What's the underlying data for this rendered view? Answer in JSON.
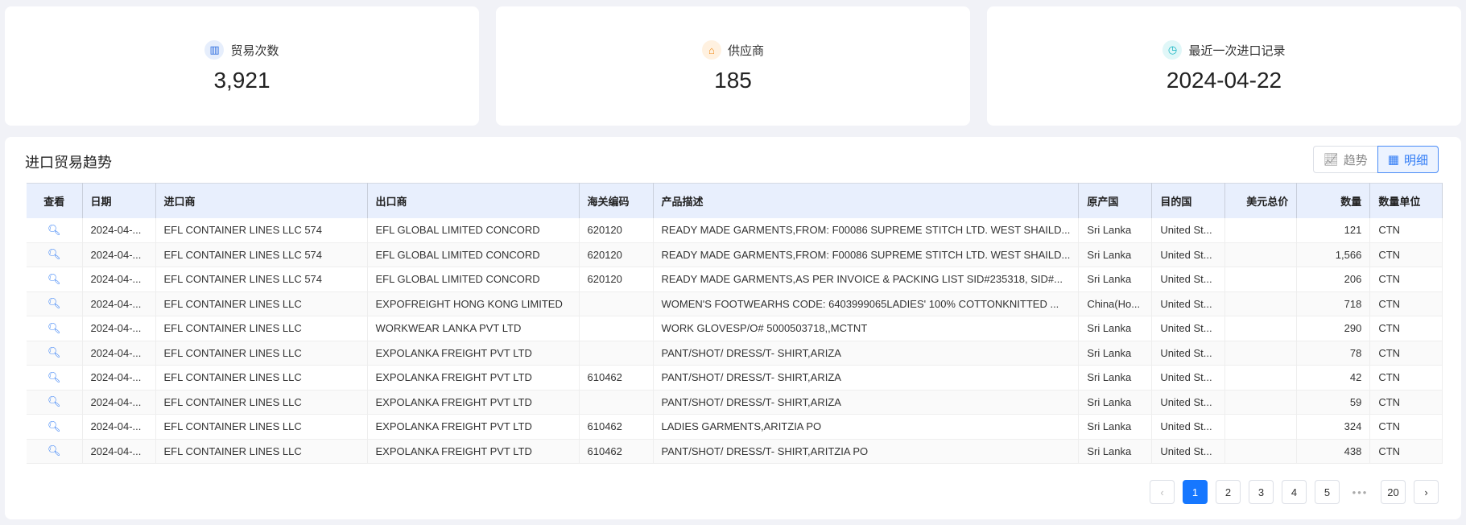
{
  "stats": [
    {
      "label": "贸易次数",
      "value": "3,921",
      "icon": "bar-chart-icon",
      "color": "#2f6fe0",
      "bg": "#e6eefc"
    },
    {
      "label": "供应商",
      "value": "185",
      "icon": "supplier-icon",
      "color": "#f08c1a",
      "bg": "#fff1e0"
    },
    {
      "label": "最近一次进口记录",
      "value": "2024-04-22",
      "icon": "clock-icon",
      "color": "#17b5c2",
      "bg": "#e0f7f8"
    }
  ],
  "section": {
    "title": "进口贸易趋势",
    "toggle": {
      "trend": "趋势",
      "detail": "明细",
      "active": "detail"
    }
  },
  "table": {
    "headers": [
      "查看",
      "日期",
      "进口商",
      "出口商",
      "海关编码",
      "产品描述",
      "原产国",
      "目的国",
      "美元总价",
      "数量",
      "数量单位"
    ],
    "rows": [
      [
        "",
        "2024-04-...",
        "EFL CONTAINER LINES LLC 574",
        "EFL GLOBAL LIMITED CONCORD",
        "620120",
        "READY MADE GARMENTS,FROM: F00086 SUPREME STITCH LTD. WEST SHAILD...",
        "Sri Lanka",
        "United St...",
        "",
        "121",
        "CTN"
      ],
      [
        "",
        "2024-04-...",
        "EFL CONTAINER LINES LLC 574",
        "EFL GLOBAL LIMITED CONCORD",
        "620120",
        "READY MADE GARMENTS,FROM: F00086 SUPREME STITCH LTD. WEST SHAILD...",
        "Sri Lanka",
        "United St...",
        "",
        "1,566",
        "CTN"
      ],
      [
        "",
        "2024-04-...",
        "EFL CONTAINER LINES LLC 574",
        "EFL GLOBAL LIMITED CONCORD",
        "620120",
        "READY MADE GARMENTS,AS PER INVOICE & PACKING LIST SID#235318, SID#...",
        "Sri Lanka",
        "United St...",
        "",
        "206",
        "CTN"
      ],
      [
        "",
        "2024-04-...",
        "EFL CONTAINER LINES LLC",
        "EXPOFREIGHT HONG KONG LIMITED",
        "",
        "WOMEN'S FOOTWEARHS CODE: 6403999065LADIES' 100% COTTONKNITTED ...",
        "China(Ho...",
        "United St...",
        "",
        "718",
        "CTN"
      ],
      [
        "",
        "2024-04-...",
        "EFL CONTAINER LINES LLC",
        "WORKWEAR LANKA PVT LTD",
        "",
        "WORK GLOVESP/O# 5000503718,,MCTNT",
        "Sri Lanka",
        "United St...",
        "",
        "290",
        "CTN"
      ],
      [
        "",
        "2024-04-...",
        "EFL CONTAINER LINES LLC",
        "EXPOLANKA FREIGHT PVT LTD",
        "",
        "PANT/SHOT/ DRESS/T- SHIRT,ARIZA",
        "Sri Lanka",
        "United St...",
        "",
        "78",
        "CTN"
      ],
      [
        "",
        "2024-04-...",
        "EFL CONTAINER LINES LLC",
        "EXPOLANKA FREIGHT PVT LTD",
        "610462",
        "PANT/SHOT/ DRESS/T- SHIRT,ARIZA",
        "Sri Lanka",
        "United St...",
        "",
        "42",
        "CTN"
      ],
      [
        "",
        "2024-04-...",
        "EFL CONTAINER LINES LLC",
        "EXPOLANKA FREIGHT PVT LTD",
        "",
        "PANT/SHOT/ DRESS/T- SHIRT,ARIZA",
        "Sri Lanka",
        "United St...",
        "",
        "59",
        "CTN"
      ],
      [
        "",
        "2024-04-...",
        "EFL CONTAINER LINES LLC",
        "EXPOLANKA FREIGHT PVT LTD",
        "610462",
        "LADIES GARMENTS,ARITZIA PO",
        "Sri Lanka",
        "United St...",
        "",
        "324",
        "CTN"
      ],
      [
        "",
        "2024-04-...",
        "EFL CONTAINER LINES LLC",
        "EXPOLANKA FREIGHT PVT LTD",
        "610462",
        "PANT/SHOT/ DRESS/T- SHIRT,ARITZIA PO",
        "Sri Lanka",
        "United St...",
        "",
        "438",
        "CTN"
      ]
    ]
  },
  "pagination": {
    "prev": "‹",
    "next": "›",
    "pages": [
      "1",
      "2",
      "3",
      "4",
      "5",
      "•••",
      "20"
    ],
    "current": "1"
  }
}
